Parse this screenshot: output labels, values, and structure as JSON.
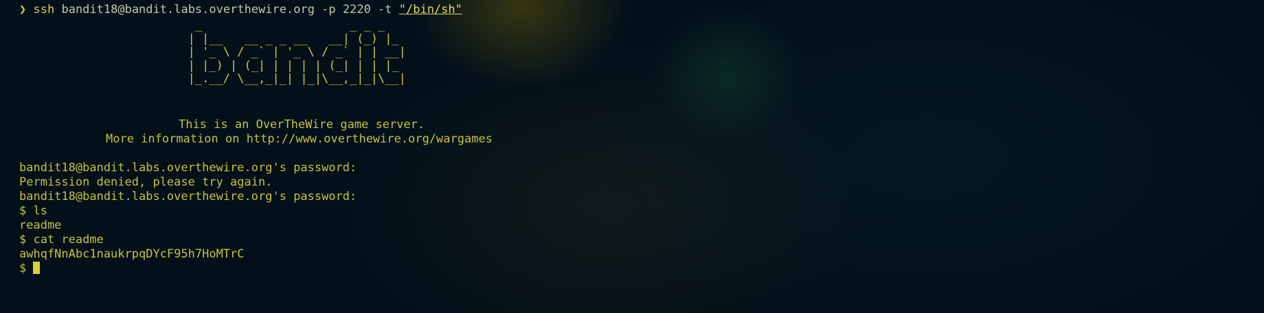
{
  "terminal": {
    "command": {
      "chevron": "❯",
      "program": "ssh",
      "args": "bandit18@bandit.labs.overthewire.org -p 2220 -t",
      "quoted": "\"/bin/sh\""
    },
    "banner_art": "                         _                     _ _ _   \n                        | |__   __ _ _ __   __| (_) |_ \n                        | '_ \\ / _` | '_ \\ / _` | | __|\n                        | |_) | (_| | | | | (_| | | |_ \n                        |_.__/ \\__,_|_| |_|\\__,_|_|\\__|",
    "server_notice": "This is an OverTheWire game server.",
    "info_line": "More information on http://www.overthewire.org/wargames",
    "session_lines": [
      "bandit18@bandit.labs.overthewire.org's password:",
      "Permission denied, please try again.",
      "bandit18@bandit.labs.overthewire.org's password:",
      "$ ls",
      "readme",
      "$ cat readme",
      "awhqfNnAbc1naukrpqDYcF95h7HoMTrC"
    ],
    "final_prompt": "$ "
  },
  "colors": {
    "background": "#03101a",
    "text": "#c8c23a",
    "cursor": "#d8d03a"
  }
}
